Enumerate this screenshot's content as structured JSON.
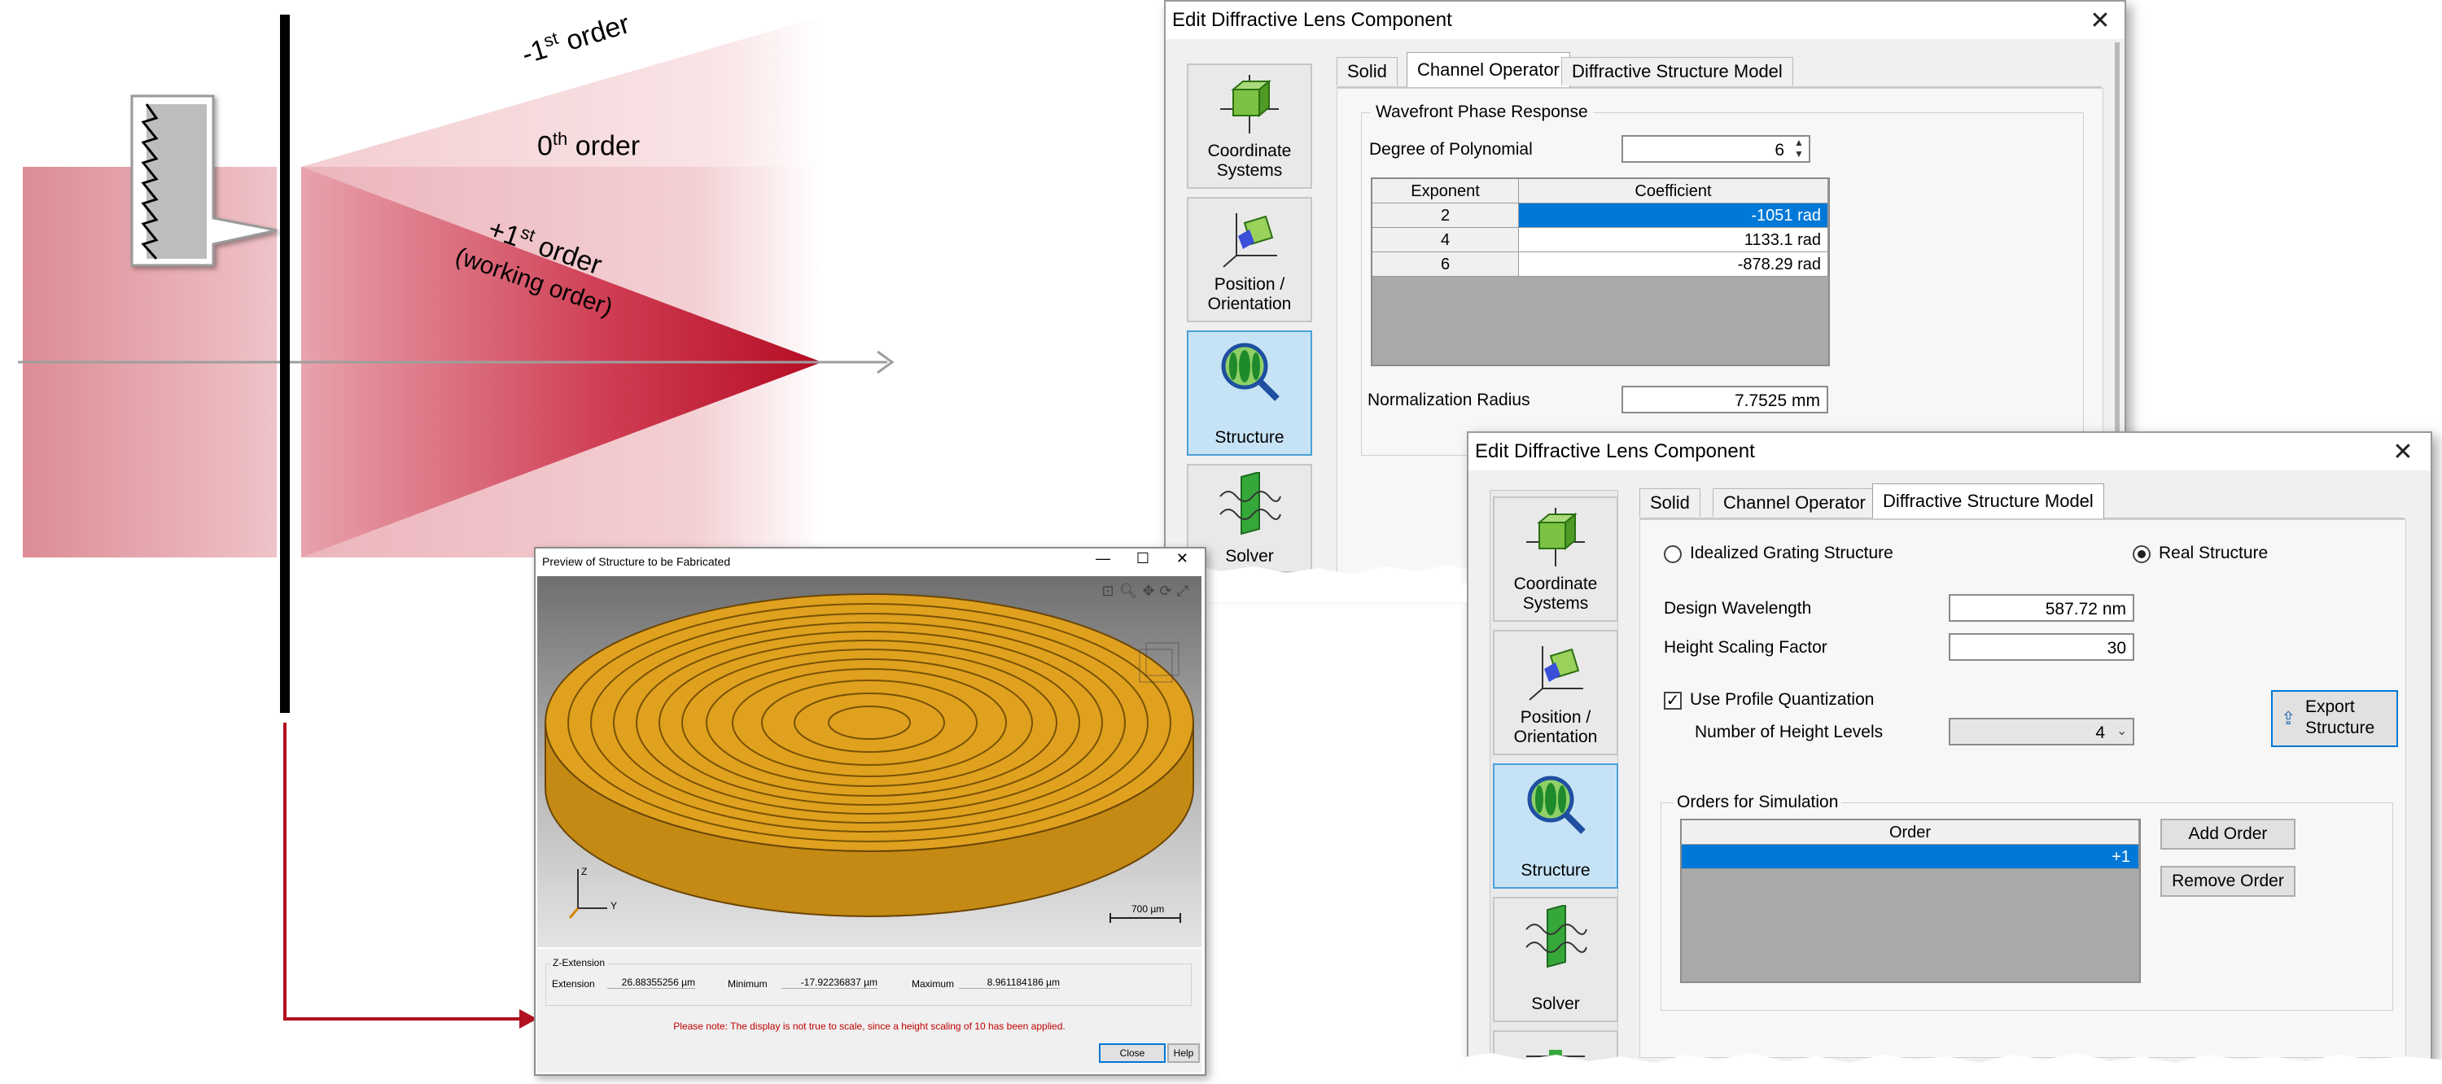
{
  "diagram": {
    "order_minus1": {
      "prefix": "-1",
      "sup": "st",
      "suffix": " order"
    },
    "order_0": {
      "prefix": "0",
      "sup": "th",
      "suffix": " order"
    },
    "order_plus1": {
      "prefix": "+1",
      "sup": "st",
      "suffix": " order"
    },
    "working_order": "(working order)",
    "colors": {
      "beam": "#c8102e",
      "arrow": "#b01020",
      "lens": "#000000"
    }
  },
  "dialog1": {
    "title": "Edit Diffractive Lens Component",
    "close_icon": "close-icon",
    "tabs": [
      "Solid",
      "Channel Operator",
      "Diffractive Structure Model"
    ],
    "active_tab": "Channel Operator",
    "sidebar": [
      {
        "label_line1": "Coordinate",
        "label_line2": "Systems",
        "icon": "coordinate-systems-icon"
      },
      {
        "label_line1": "Position /",
        "label_line2": "Orientation",
        "icon": "position-orientation-icon"
      },
      {
        "label_line1": "Structure",
        "label_line2": "",
        "icon": "structure-icon"
      },
      {
        "label_line1": "Solver",
        "label_line2": "",
        "icon": "solver-icon"
      }
    ],
    "group_title": "Wavefront Phase Response",
    "degree_label": "Degree of Polynomial",
    "degree_value": "6",
    "table_headers": [
      "Exponent",
      "Coefficient"
    ],
    "rows": [
      {
        "exponent": "2",
        "coefficient": "-1051 rad"
      },
      {
        "exponent": "4",
        "coefficient": "1133.1 rad"
      },
      {
        "exponent": "6",
        "coefficient": "-878.29 rad"
      }
    ],
    "norm_label": "Normalization Radius",
    "norm_value": "7.7525 mm"
  },
  "dialog2": {
    "title": "Edit Diffractive Lens Component",
    "tabs": [
      "Solid",
      "Channel Operator",
      "Diffractive Structure Model"
    ],
    "active_tab": "Diffractive Structure Model",
    "sidebar": [
      {
        "label_line1": "Coordinate",
        "label_line2": "Systems"
      },
      {
        "label_line1": "Position /",
        "label_line2": "Orientation"
      },
      {
        "label_line1": "Structure",
        "label_line2": ""
      },
      {
        "label_line1": "Solver",
        "label_line2": ""
      }
    ],
    "radio_idealized": "Idealized Grating Structure",
    "radio_real": "Real Structure",
    "selected_model": "Real Structure",
    "wavelength_label": "Design Wavelength",
    "wavelength_value": "587.72 nm",
    "height_scaling_label": "Height Scaling Factor",
    "height_scaling_value": "30",
    "use_quant_label": "Use Profile Quantization",
    "use_quant_checked": true,
    "levels_label": "Number of Height Levels",
    "levels_value": "4",
    "export_label_line1": "Export",
    "export_label_line2": "Structure",
    "orders_group": "Orders for Simulation",
    "orders_header": "Order",
    "orders": [
      "+1"
    ],
    "add_order": "Add Order",
    "remove_order": "Remove Order"
  },
  "preview": {
    "title": "Preview of Structure to be Fabricated",
    "toolbar_icons": [
      "zoom-fit-icon",
      "zoom-icon",
      "pan-icon",
      "rotate-icon",
      "fullscreen-icon"
    ],
    "axis_z": "Z",
    "axis_y": "Y",
    "scale_bar": "700 µm",
    "zext_title": "Z-Extension",
    "extension_label": "Extension",
    "extension_value": "26.88355256 µm",
    "minimum_label": "Minimum",
    "minimum_value": "-17.92236837 µm",
    "maximum_label": "Maximum",
    "maximum_value": "8.961184186 µm",
    "note": "Please note: The display is not true to scale, since a height scaling of 10 has been applied.",
    "close_button": "Close",
    "help_button": "Help",
    "lens_color": "#e0a11f"
  }
}
